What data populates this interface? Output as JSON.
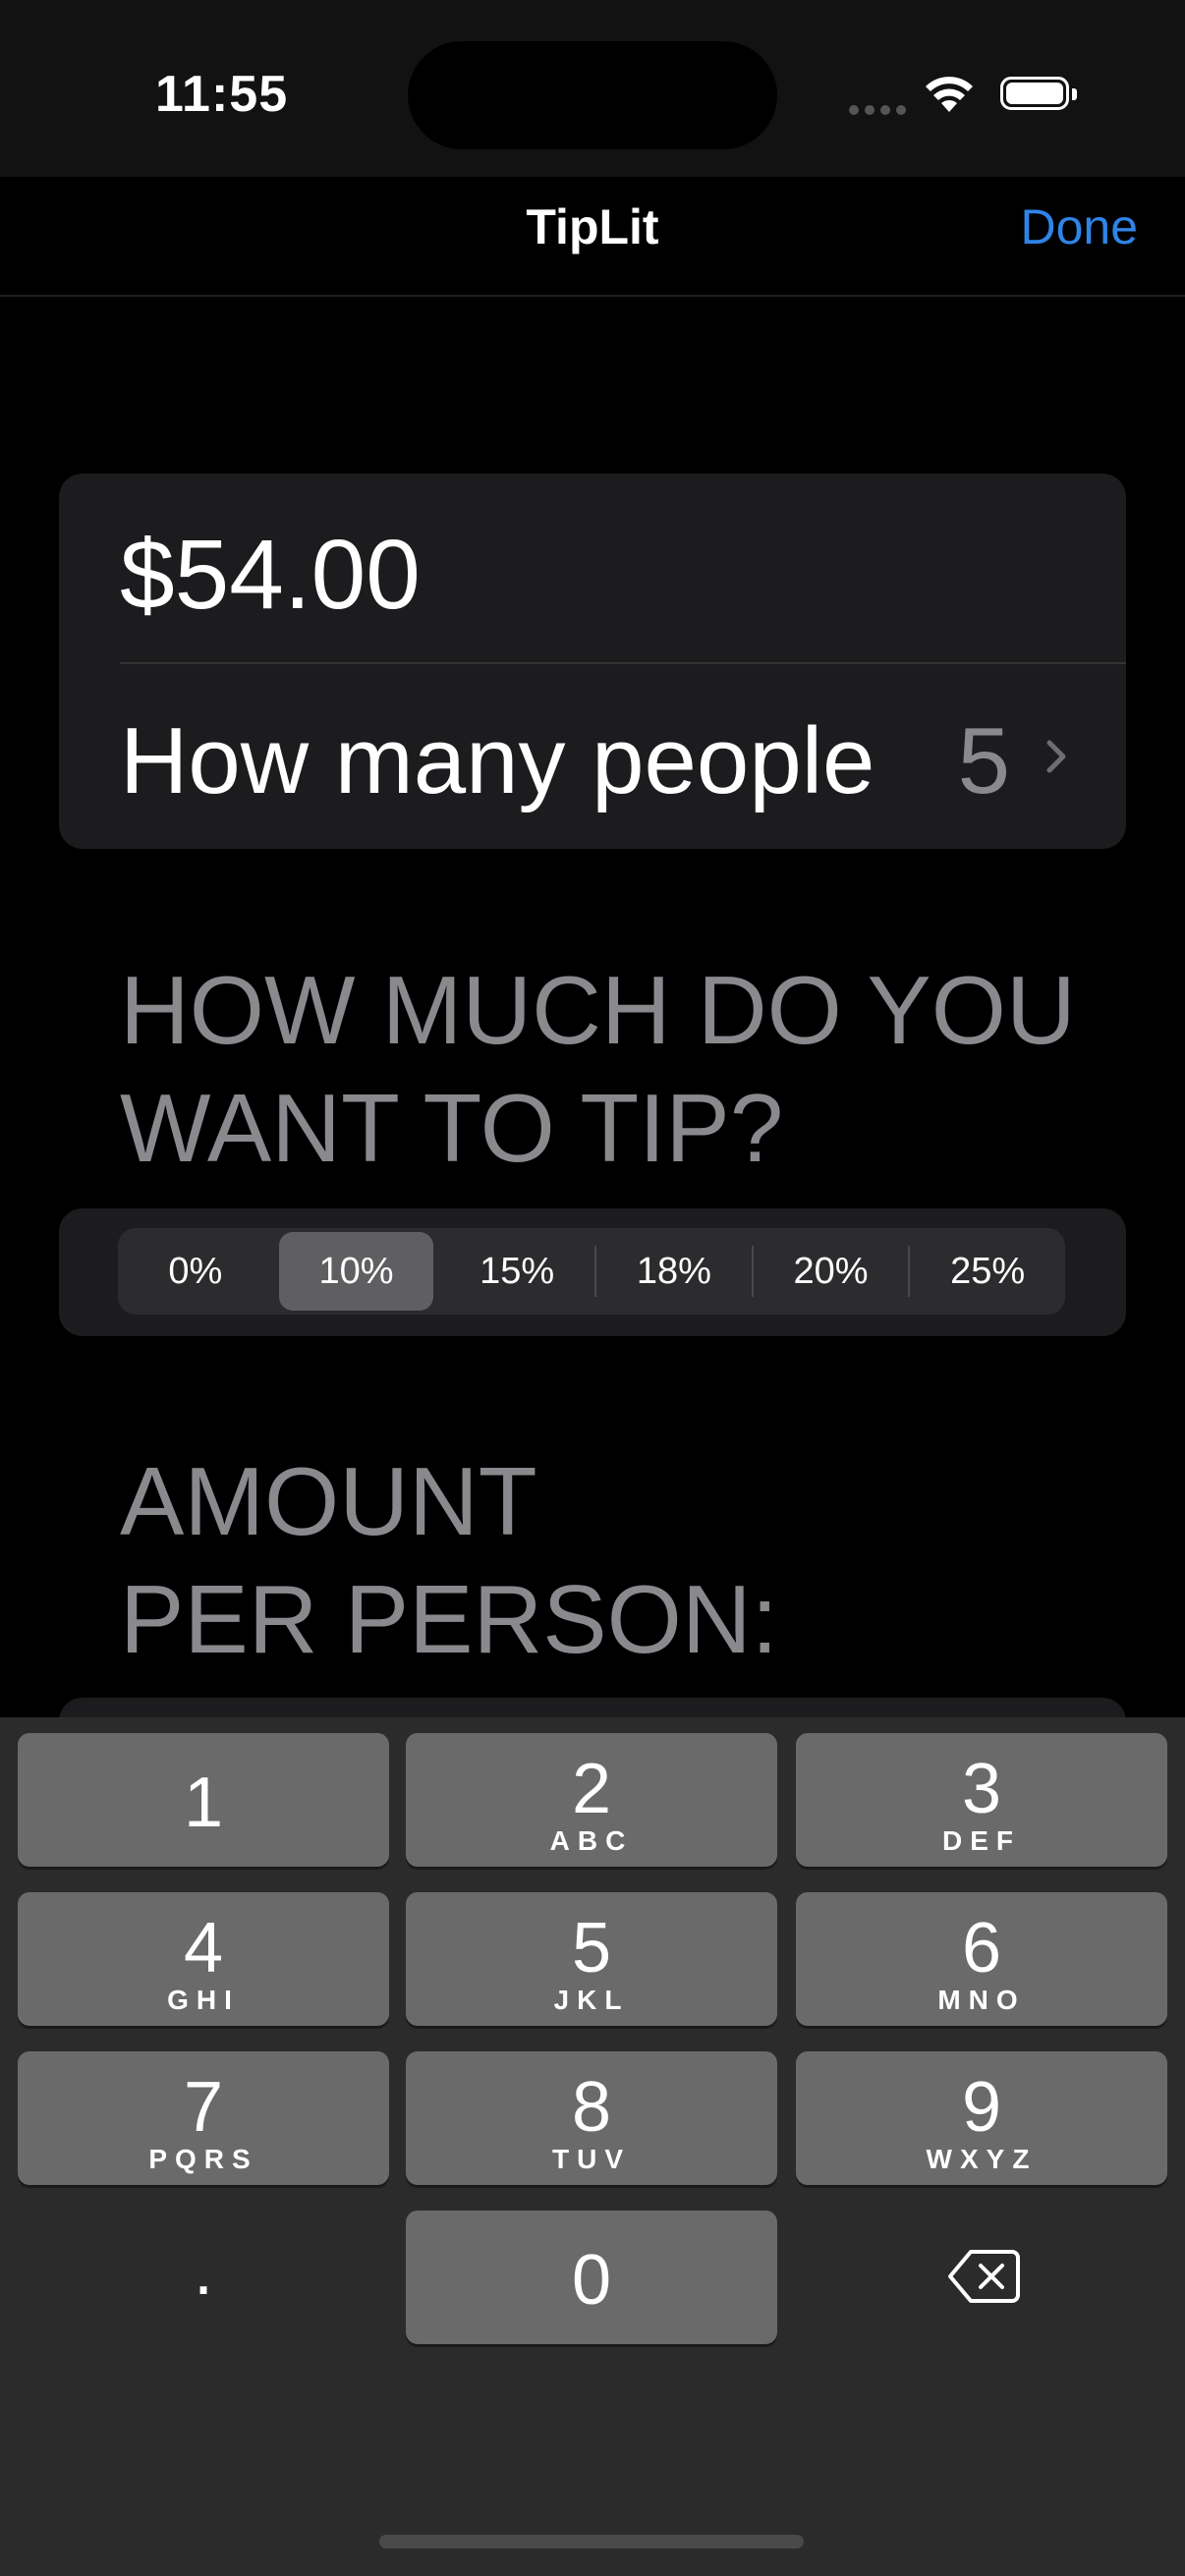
{
  "status_bar": {
    "time": "11:55",
    "icons": [
      "cellular-signal-icon",
      "wifi-icon",
      "battery-icon"
    ]
  },
  "nav": {
    "title": "TipLit",
    "done_label": "Done",
    "done_color": "#2f84e6"
  },
  "bill": {
    "amount": "$54.00",
    "people_label": "How many people",
    "people_value": "5"
  },
  "tip_section": {
    "title_line1": "HOW MUCH DO YOU",
    "title_line2": "WANT TO TIP?",
    "options": [
      "0%",
      "10%",
      "15%",
      "18%",
      "20%",
      "25%"
    ],
    "selected": "10%"
  },
  "amount_section": {
    "title_line1": "AMOUNT",
    "title_line2": "PER PERSON:"
  },
  "keyboard": {
    "keys": [
      {
        "digit": "1",
        "letters": ""
      },
      {
        "digit": "2",
        "letters": "ABC"
      },
      {
        "digit": "3",
        "letters": "DEF"
      },
      {
        "digit": "4",
        "letters": "GHI"
      },
      {
        "digit": "5",
        "letters": "JKL"
      },
      {
        "digit": "6",
        "letters": "MNO"
      },
      {
        "digit": "7",
        "letters": "PQRS"
      },
      {
        "digit": "8",
        "letters": "TUV"
      },
      {
        "digit": "9",
        "letters": "WXYZ"
      },
      {
        "digit": ".",
        "letters": ""
      },
      {
        "digit": "0",
        "letters": ""
      }
    ],
    "backspace_icon": "delete-backward-icon"
  }
}
